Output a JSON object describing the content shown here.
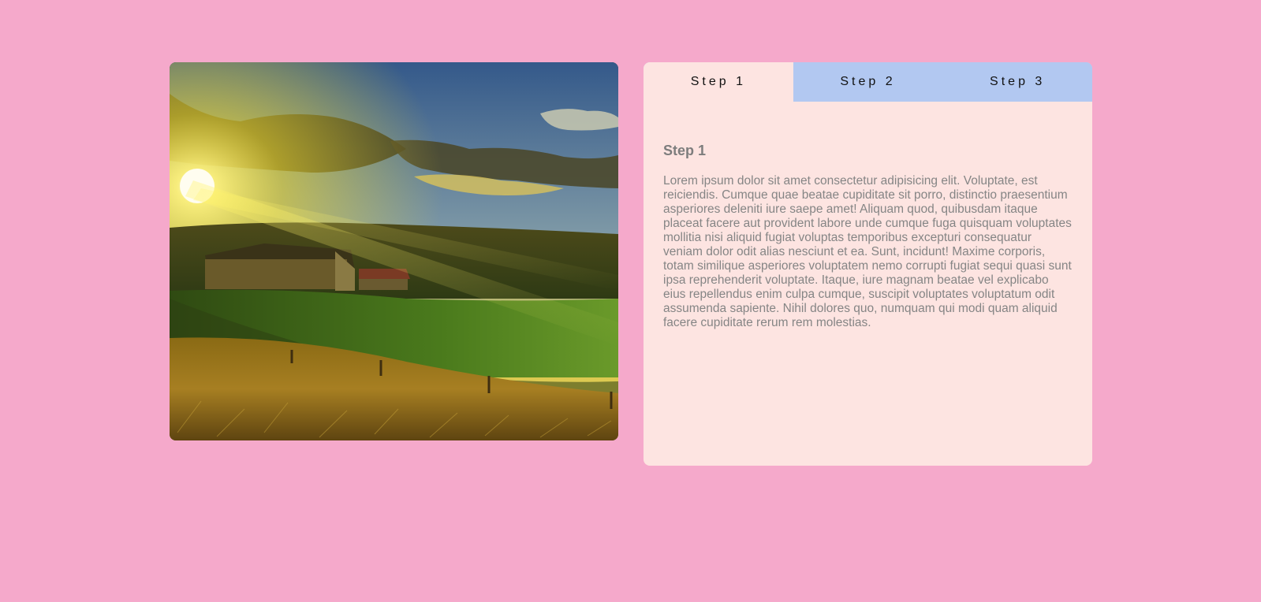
{
  "image": {
    "alt": "landscape-sunset",
    "colors": {
      "sky_top": "#3b5f8e",
      "sun": "#fff8c0",
      "grass": "#4f7a1e",
      "field": "#9a7a20"
    }
  },
  "tabs": [
    {
      "label": "Step 1",
      "active": true
    },
    {
      "label": "Step 2",
      "active": false
    },
    {
      "label": "Step 3",
      "active": false
    }
  ],
  "panel": {
    "title": "Step 1",
    "body": "Lorem ipsum dolor sit amet consectetur adipisicing elit. Voluptate, est reiciendis. Cumque quae beatae cupiditate sit porro, distinctio praesentium asperiores deleniti iure saepe amet! Aliquam quod, quibusdam itaque placeat facere aut provident labore unde cumque fuga quisquam voluptates mollitia nisi aliquid fugiat voluptas temporibus excepturi consequatur veniam dolor odit alias nesciunt et ea. Sunt, incidunt! Maxime corporis, totam similique asperiores voluptatem nemo corrupti fugiat sequi quasi sunt ipsa reprehenderit voluptate. Itaque, iure magnam beatae vel explicabo eius repellendus enim culpa cumque, suscipit voluptates voluptatum odit assumenda sapiente. Nihil dolores quo, numquam qui modi quam aliquid facere cupiditate rerum rem molestias."
  },
  "colors": {
    "page_background": "#f5a9cb",
    "panel_background": "#fde4e1",
    "tab_inactive": "#b2c8f1",
    "panel_text": "#858585"
  }
}
